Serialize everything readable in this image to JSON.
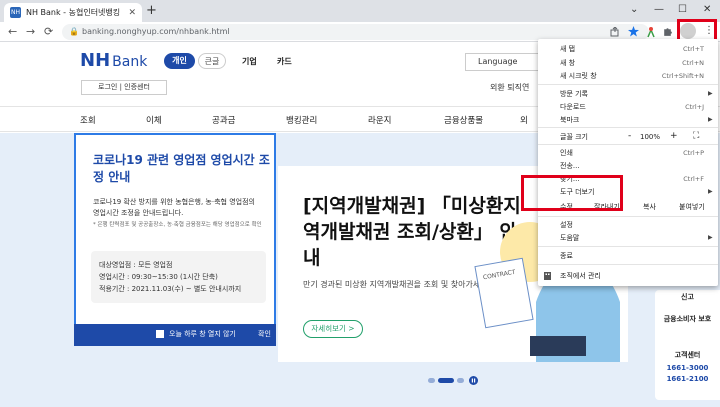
{
  "browser": {
    "tab_title": "NH Bank - 농협인터넷뱅킹",
    "tab_favicon": "NH",
    "tab_close": "✕",
    "new_tab": "+",
    "window_buttons": [
      "⌄",
      "—",
      "☐",
      "✕"
    ],
    "nav_back": "←",
    "nav_forward": "→",
    "nav_reload": "⟳",
    "url": "banking.nonghyup.com/nhbank.html",
    "kebab": "⋮"
  },
  "site": {
    "logo_nh": "NH",
    "logo_bank": "Bank",
    "segment_personal": "개인",
    "segment_corp": "큰글",
    "top_links": [
      "기업",
      "카드"
    ],
    "login": "로그인 | 인증센터",
    "language": "Language",
    "util_links": "외환  퇴직연",
    "main_nav": [
      "조회",
      "이체",
      "공과금",
      "뱅킹관리",
      "라운지",
      "금융상품몰",
      "외"
    ]
  },
  "popup": {
    "title": "코로나19 관련 영업점 영업시간 조정 안내",
    "body": "코로나19 확산 방지를 위한 농협은행, 농·축협 영업점의 영업시간 조정을 안내드립니다.",
    "note": "* 은행 탄력점포 및 공공출장소, 농·축협 금융점포는 해당 영업점으로 확인",
    "box_line1": "대상영업점 : 모든 영업점",
    "box_line2": "영업시간 : 09:30~15:30 (1시간 단축)",
    "box_line3": "적용기간 : 2021.11.03(수) ~ 별도 안내시까지",
    "no_more": "오늘 하루 창 열지 않기",
    "ok": "확인"
  },
  "slide": {
    "title": "[지역개발채권] 「미상환지역개발채권 조회/상환」 안내",
    "desc": "만기 경과된 미상환 지역개발채권을 조회 및 찾아가세요.",
    "button": "자세히보기 >",
    "art_label": "CONTRACT"
  },
  "side_panel": {
    "item1": "신고",
    "item2": "금융소비자 보호",
    "item3": "고객센터",
    "phone1": "1661-3000",
    "phone2": "1661-2100"
  },
  "menu": {
    "new_tab": "새 탭",
    "new_tab_key": "Ctrl+T",
    "new_window": "새 창",
    "new_window_key": "Ctrl+N",
    "incognito": "새 시크릿 창",
    "incognito_key": "Ctrl+Shift+N",
    "history": "방문 기록",
    "downloads": "다운로드",
    "downloads_key": "Ctrl+J",
    "bookmarks": "북마크",
    "zoom": "글꼴 크기",
    "zoom_minus": "-",
    "zoom_value": "100%",
    "zoom_plus": "+",
    "fullscreen": "⛶",
    "print": "인쇄",
    "print_key": "Ctrl+P",
    "cast": "전송...",
    "find": "찾기...",
    "find_key": "Ctrl+F",
    "more_tools": "도구 더보기",
    "edit": "수정",
    "cut": "잘라내기",
    "copy": "복사",
    "paste": "붙여넣기",
    "settings": "설정",
    "help": "도움말",
    "exit": "종료",
    "managed": "조직에서 관리"
  },
  "colors": {
    "nh_blue": "#1e4aa8",
    "highlight_red": "#e0001a",
    "band_bg": "#e5eef9",
    "accent_green": "#22a06b"
  }
}
